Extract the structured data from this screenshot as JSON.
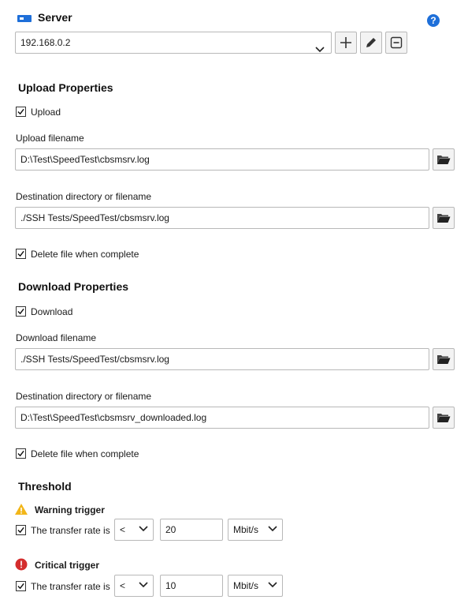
{
  "server": {
    "title": "Server",
    "selected": "192.168.0.2",
    "help_glyph": "?",
    "icons": [
      "server-icon",
      "help-icon",
      "chevron-down-icon",
      "plus-icon",
      "pencil-icon",
      "minus-box-icon"
    ]
  },
  "upload": {
    "title": "Upload Properties",
    "checkbox_label": "Upload",
    "filename_label": "Upload filename",
    "filename_value": "D:\\Test\\SpeedTest\\cbsmsrv.log",
    "dest_label": "Destination directory or filename",
    "dest_value": "./SSH Tests/SpeedTest/cbsmsrv.log",
    "delete_label": "Delete file when complete"
  },
  "download": {
    "title": "Download Properties",
    "checkbox_label": "Download",
    "filename_label": "Download filename",
    "filename_value": "./SSH Tests/SpeedTest/cbsmsrv.log",
    "dest_label": "Destination directory or filename",
    "dest_value": "D:\\Test\\SpeedTest\\cbsmsrv_downloaded.log",
    "delete_label": "Delete file when complete"
  },
  "threshold": {
    "title": "Threshold",
    "warning": {
      "title": "Warning trigger",
      "check_label": "The transfer rate is",
      "operator": "<",
      "value": "20",
      "unit": "Mbit/s"
    },
    "critical": {
      "title": "Critical trigger",
      "check_label": "The transfer rate is",
      "operator": "<",
      "value": "10",
      "unit": "Mbit/s"
    }
  },
  "colors": {
    "accent_blue": "#1e6fd9",
    "warning_yellow": "#f2b619",
    "critical_red": "#d42d2d"
  }
}
